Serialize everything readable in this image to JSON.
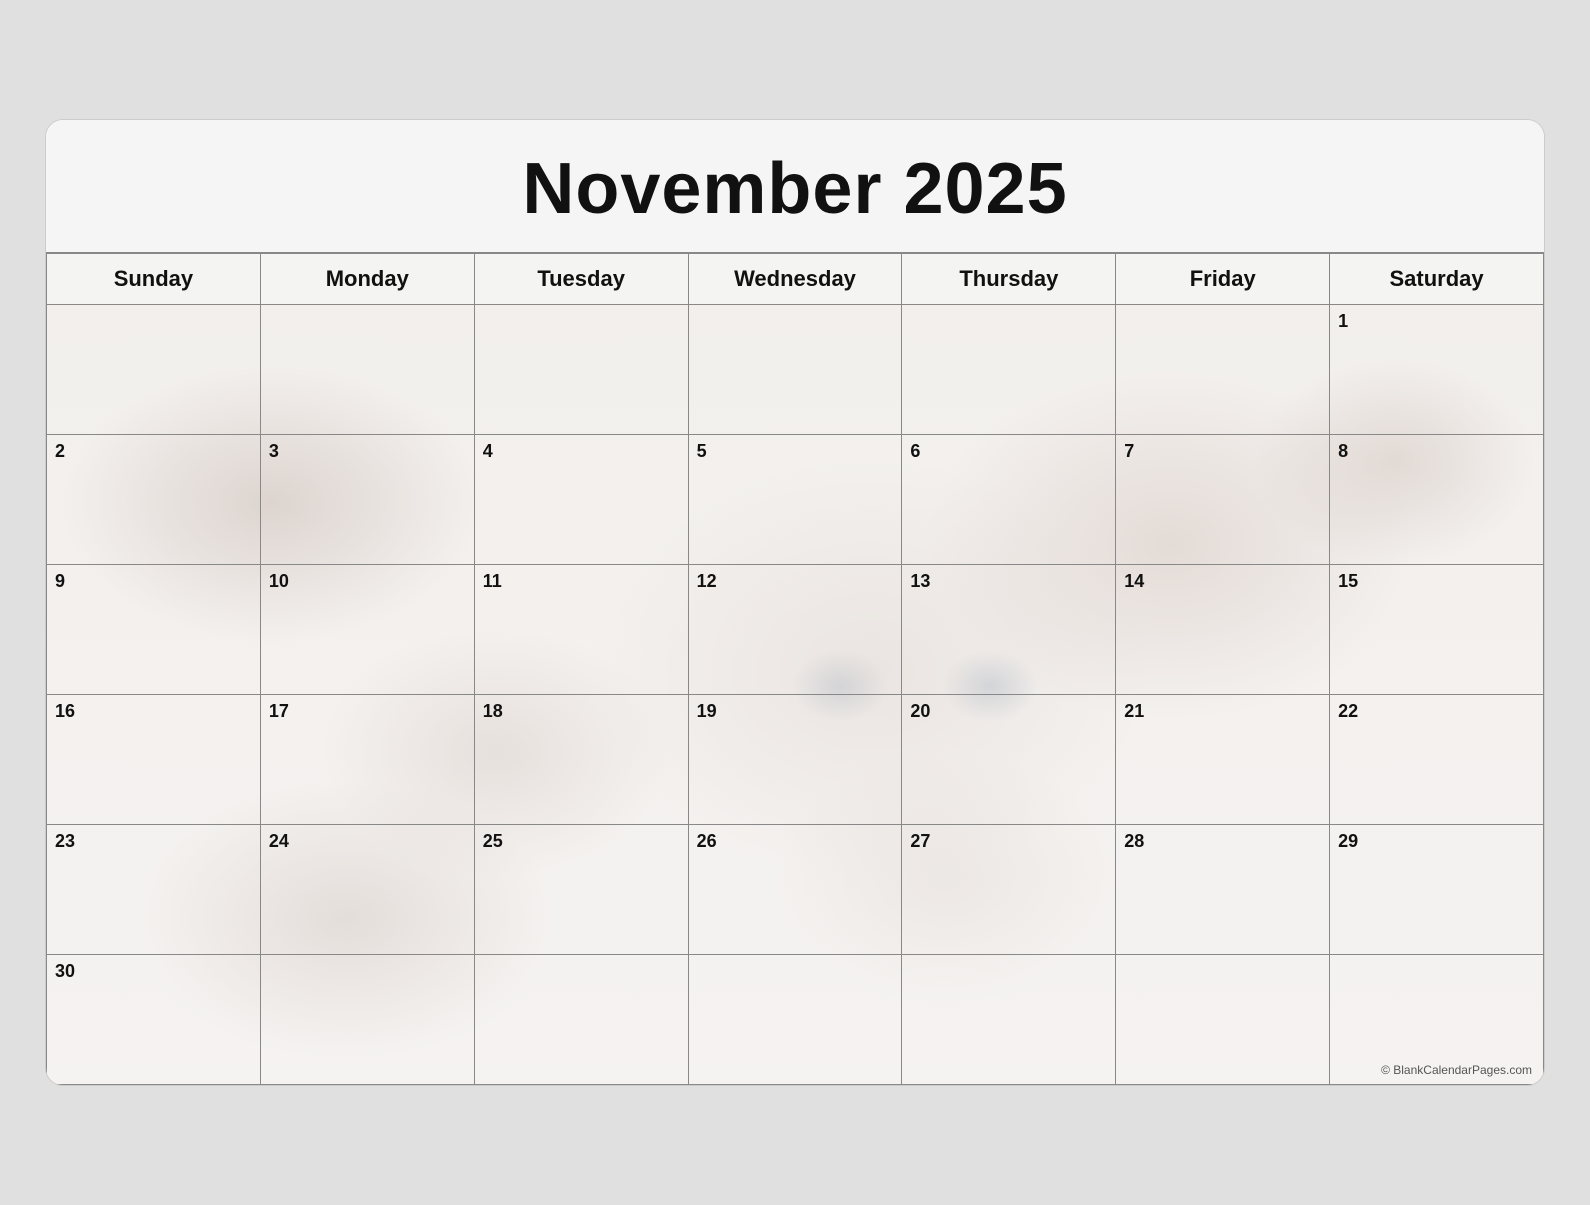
{
  "header": {
    "title": "November 2025"
  },
  "days_of_week": [
    "Sunday",
    "Monday",
    "Tuesday",
    "Wednesday",
    "Thursday",
    "Friday",
    "Saturday"
  ],
  "weeks": [
    [
      null,
      null,
      null,
      null,
      null,
      null,
      1
    ],
    [
      2,
      3,
      4,
      5,
      6,
      7,
      8
    ],
    [
      9,
      10,
      11,
      12,
      13,
      14,
      15
    ],
    [
      16,
      17,
      18,
      19,
      20,
      21,
      22
    ],
    [
      23,
      24,
      25,
      26,
      27,
      28,
      29
    ],
    [
      30,
      null,
      null,
      null,
      null,
      null,
      null
    ]
  ],
  "copyright": "© BlankCalendarPages.com"
}
